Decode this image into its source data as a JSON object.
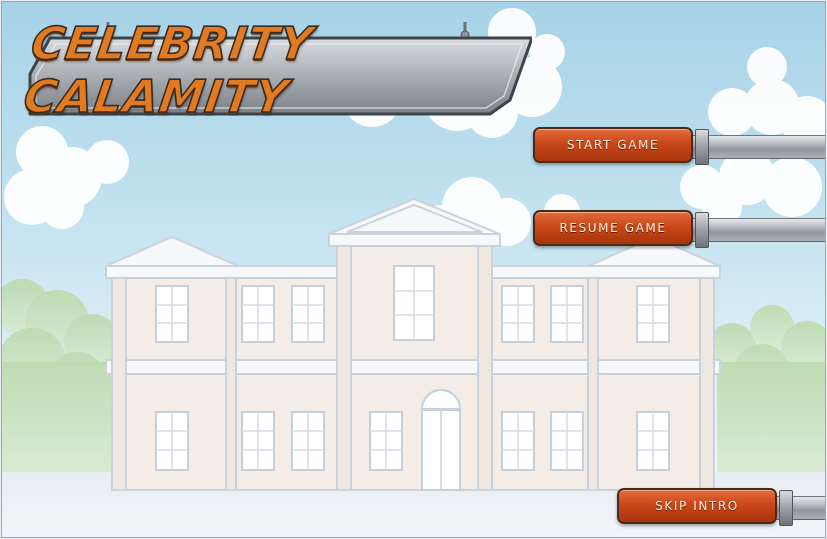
{
  "title": "Celebrity Calamity",
  "buttons": {
    "start": "START GAME",
    "resume": "RESUME GAME",
    "skip": "SKIP INTRO"
  },
  "colors": {
    "button_fill": "#c94718",
    "title_fill": "#e27a1f",
    "sky": "#a7d3e8"
  },
  "icons": {
    "sign_hooks": "hook-icon",
    "door": "door-icon"
  }
}
